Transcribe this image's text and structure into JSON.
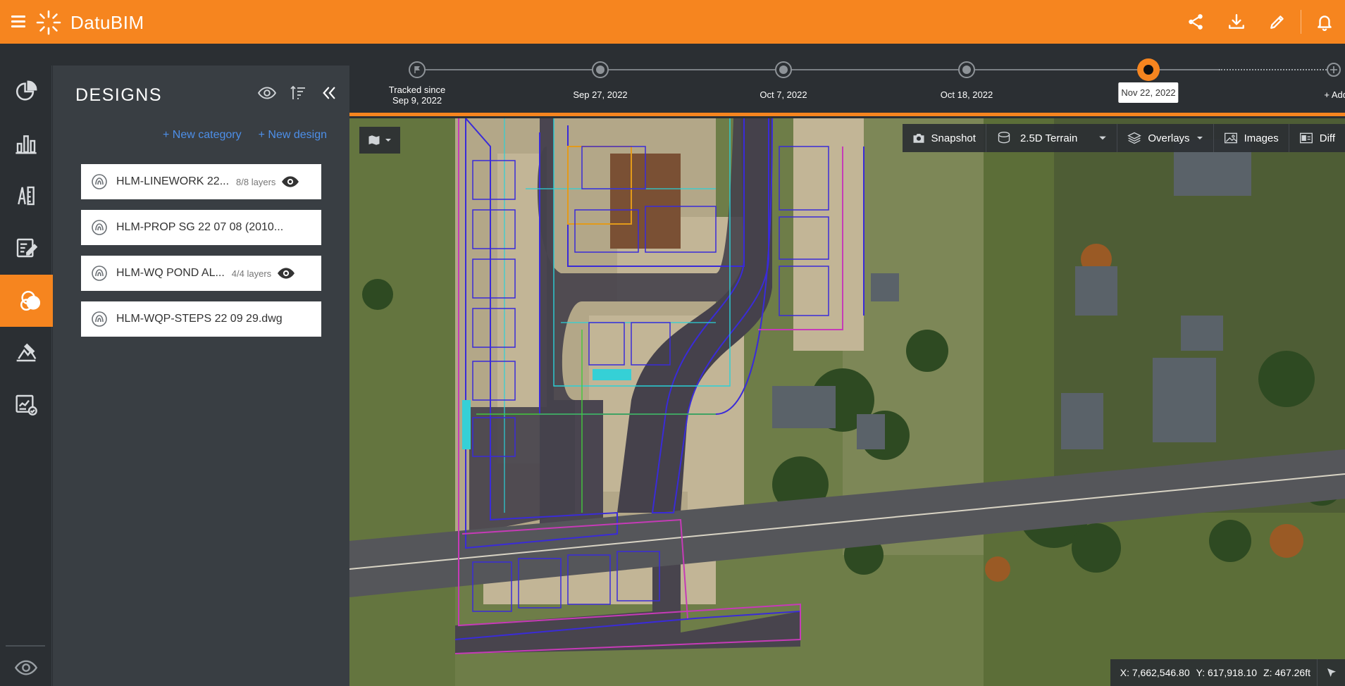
{
  "app": {
    "name": "DatuBIM"
  },
  "header": {
    "actions": [
      {
        "icon": "share-icon"
      },
      {
        "icon": "download-icon"
      },
      {
        "icon": "edit-icon"
      },
      {
        "icon": "bell-icon"
      }
    ]
  },
  "rail": {
    "items": [
      {
        "icon": "pie-chart-icon"
      },
      {
        "icon": "bar-chart-icon"
      },
      {
        "icon": "measure-icon"
      },
      {
        "icon": "report-icon"
      },
      {
        "icon": "designs-icon",
        "active": true
      },
      {
        "icon": "inspection-icon"
      },
      {
        "icon": "analytics-report-icon"
      }
    ],
    "bottom_icon": "eye-icon"
  },
  "panel": {
    "title": "DESIGNS",
    "new_category": "+ New category",
    "new_design": "+ New design",
    "designs": [
      {
        "name": "HLM-LINEWORK 22...",
        "layers": "8/8 layers",
        "visible": true
      },
      {
        "name": "HLM-PROP SG 22 07 08 (2010...",
        "layers": "",
        "visible": false
      },
      {
        "name": "HLM-WQ POND AL...",
        "layers": "4/4 layers",
        "visible": true
      },
      {
        "name": "HLM-WQP-STEPS 22 09 29.dwg",
        "layers": "",
        "visible": false
      }
    ]
  },
  "timeline": {
    "first_line1": "Tracked since",
    "first_line2": "Sep 9, 2022",
    "dates": [
      "Sep 27, 2022",
      "Oct 7, 2022",
      "Oct 18, 2022"
    ],
    "current": "Nov 22, 2022",
    "add_label": "+ Add"
  },
  "map_toolbar": {
    "snapshot": "Snapshot",
    "terrain": "2.5D Terrain",
    "overlays": "Overlays",
    "images": "Images",
    "diff": "Diff"
  },
  "coords": {
    "x": "X: 7,662,546.80",
    "y": "Y: 617,918.10",
    "z": "Z: 467.26ft"
  },
  "colors": {
    "accent": "#f6851f",
    "dark": "#2b2f33",
    "panel": "#393e43",
    "link": "#4d8fe9"
  }
}
